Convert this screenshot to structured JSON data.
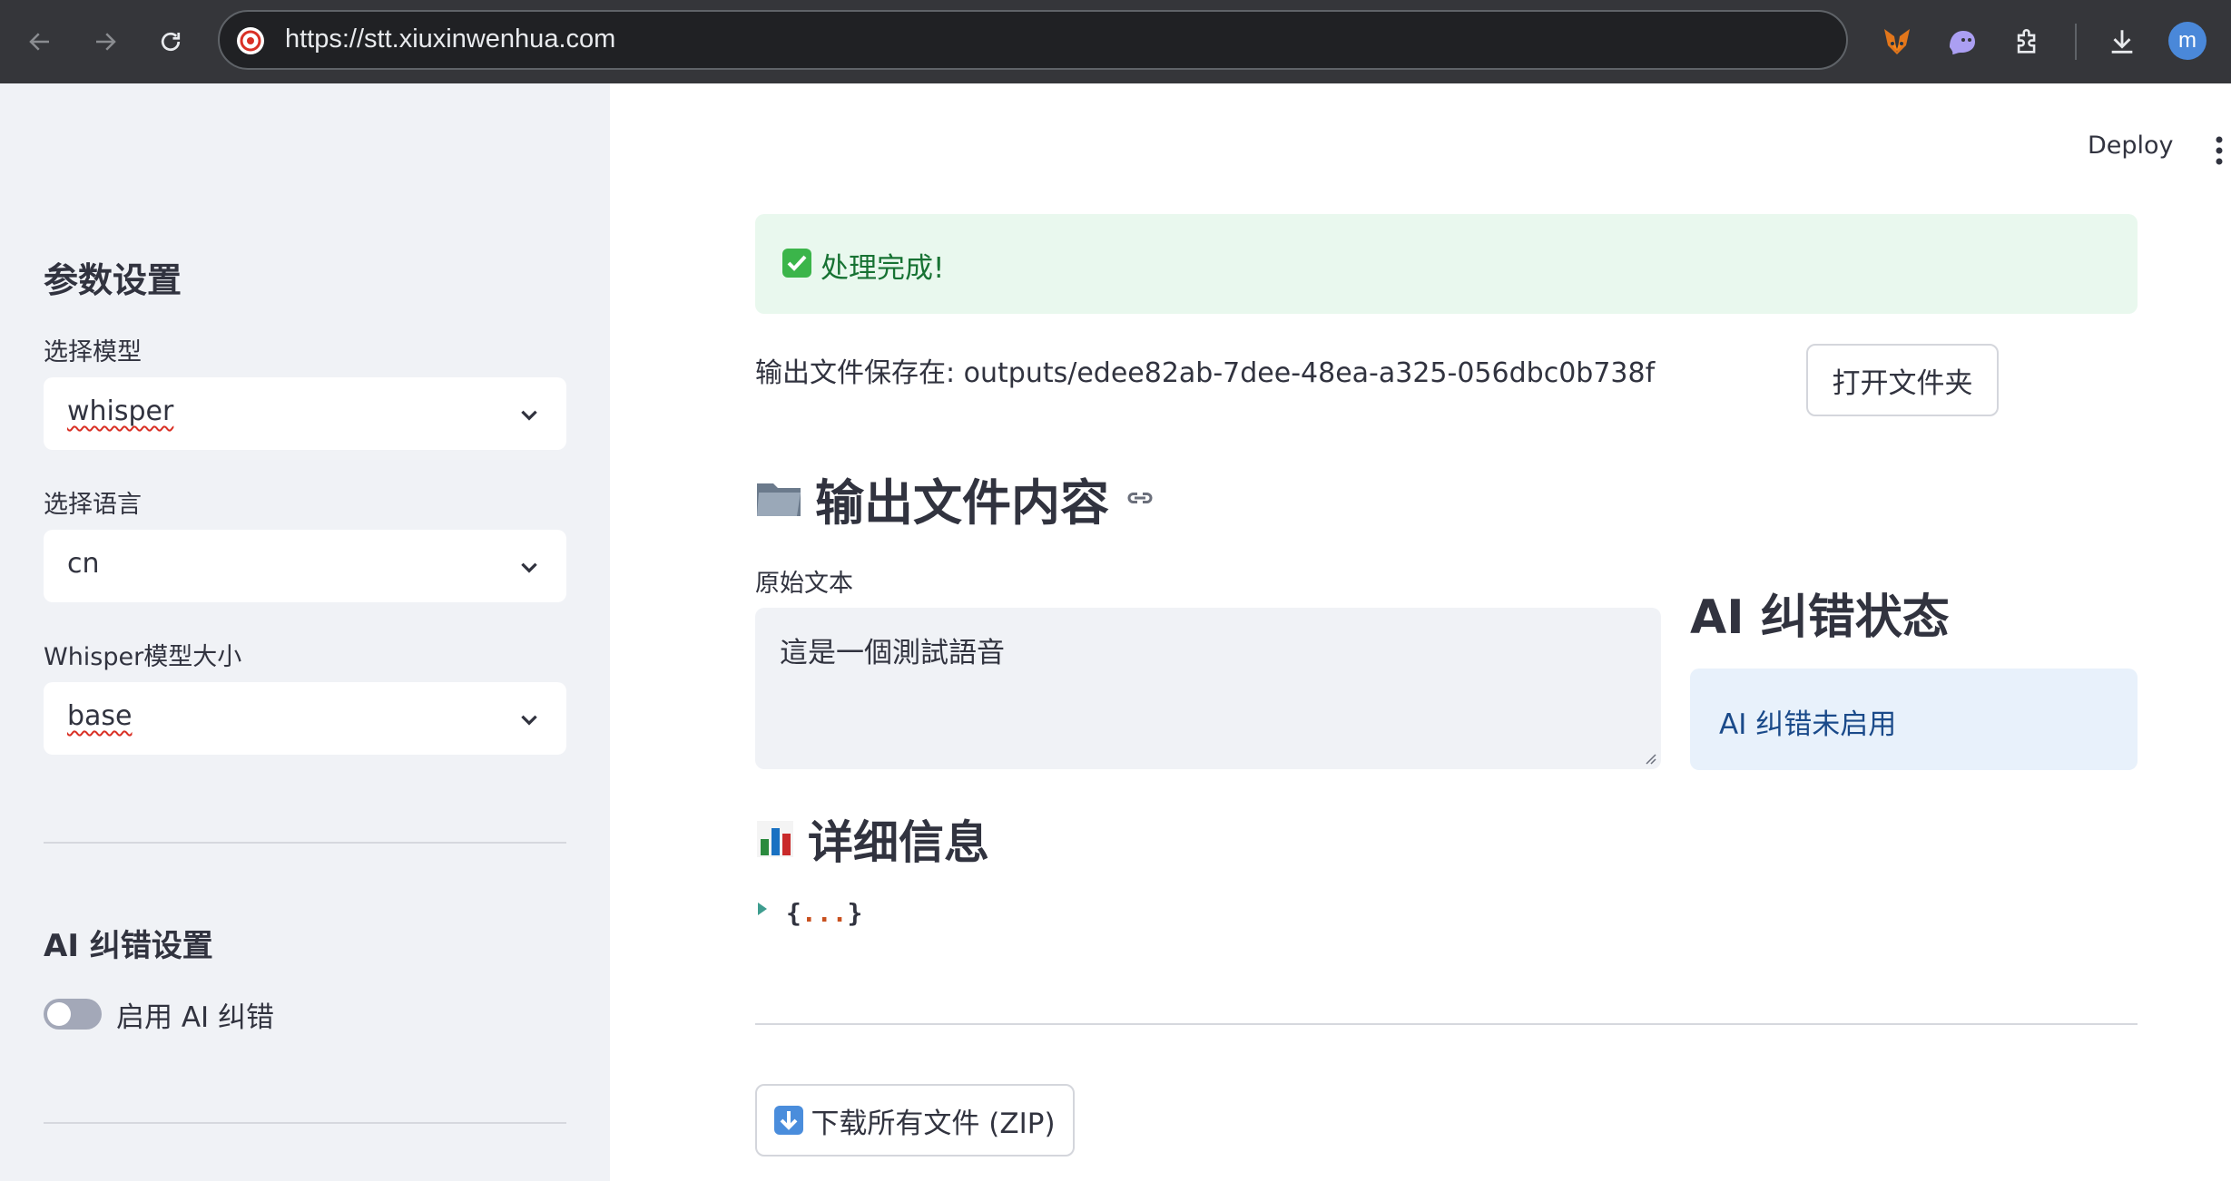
{
  "browser": {
    "url": "https://stt.xiuxinwenhua.com",
    "profile_initial": "m",
    "icons": {
      "back": "arrow-left-icon",
      "forward": "arrow-right-icon",
      "reload": "reload-icon",
      "site": "site-favicon-icon",
      "ext1": "metamask-fox-icon",
      "ext2": "ghost-extension-icon",
      "ext3": "puzzle-extensions-icon",
      "download": "download-icon"
    }
  },
  "sidebar": {
    "title": "参数设置",
    "model": {
      "label": "选择模型",
      "value": "whisper"
    },
    "language": {
      "label": "选择语言",
      "value": "cn"
    },
    "model_size": {
      "label": "Whisper模型大小",
      "value": "base"
    },
    "ai_section": {
      "title": "AI 纠错设置",
      "toggle_label": "启用 AI 纠错",
      "toggle_on": false
    }
  },
  "header": {
    "deploy_label": "Deploy"
  },
  "main": {
    "success_message": "处理完成!",
    "output_path_text": "输出文件保存在: outputs/edee82ab-7dee-48ea-a325-056dbc0b738f",
    "open_folder_label": "打开文件夹",
    "output_heading": "输出文件内容",
    "raw_text_label": "原始文本",
    "raw_text_value": "這是一個測試語音",
    "ai_status_heading": "AI 纠错状态",
    "ai_status_message": "AI 纠错未启用",
    "detail_heading": "详细信息",
    "json_open": "{",
    "json_dots": "...",
    "json_close": "}",
    "download_label": "下载所有文件 (ZIP)"
  },
  "colors": {
    "chrome_bg": "#35363a",
    "sidebar_bg": "#f0f2f6",
    "success_bg": "#e9f8ee",
    "success_text": "#177233",
    "info_bg": "#e8f1fb",
    "info_text": "#1a4a8a"
  }
}
